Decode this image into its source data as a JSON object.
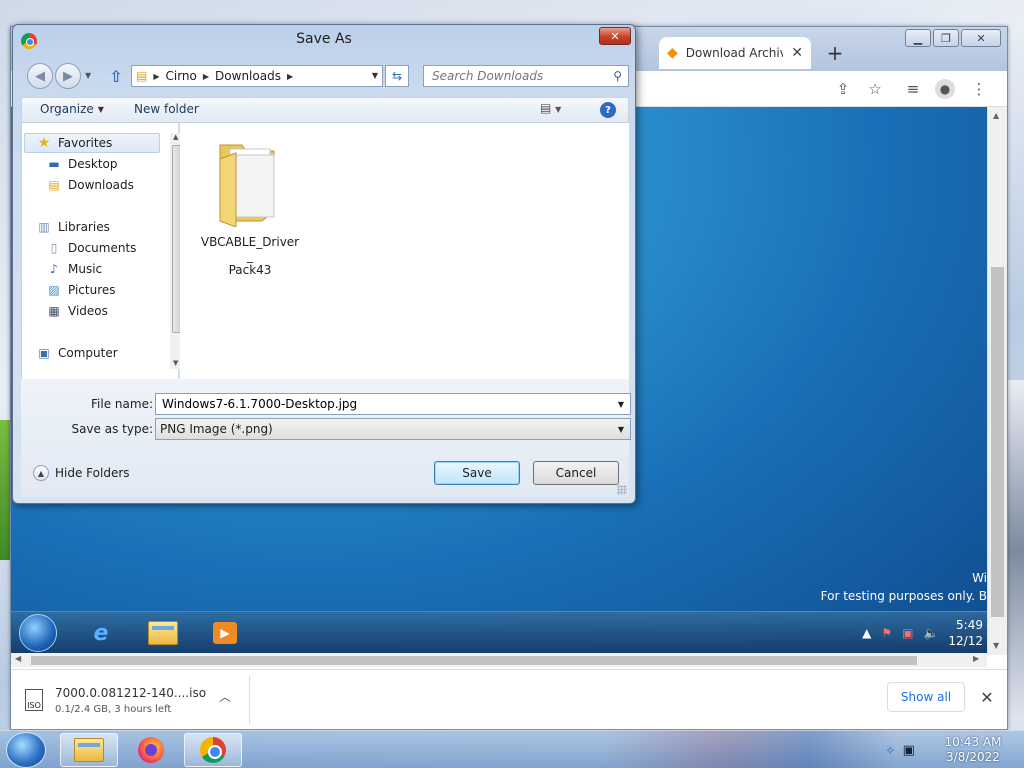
{
  "dialog": {
    "title": "Save As",
    "nav": {
      "path": [
        "Cirno",
        "Downloads"
      ],
      "search_placeholder": "Search Downloads"
    },
    "commands": {
      "organize": "Organize",
      "new_folder": "New folder"
    },
    "nav_pane": {
      "favorites": "Favorites",
      "desktop": "Desktop",
      "downloads": "Downloads",
      "libraries": "Libraries",
      "documents": "Documents",
      "music": "Music",
      "pictures": "Pictures",
      "videos": "Videos",
      "computer": "Computer"
    },
    "files": [
      {
        "name": "VBCABLE_Driver_\nPack43",
        "type": "folder"
      }
    ],
    "file_name_label": "File name:",
    "file_name_value": "Windows7-6.1.7000-Desktop.jpg",
    "save_type_label": "Save as type:",
    "save_type_value": "PNG Image (*.png)",
    "save_label": "Save",
    "cancel_label": "Cancel",
    "hide_folders_label": "Hide Folders"
  },
  "browser": {
    "tab_title": "Download Archiv",
    "content": {
      "watermark_line1": "Wi",
      "watermark_line2": "For testing purposes only. B",
      "vm_clock_time": "5:49",
      "vm_clock_date": "12/12"
    },
    "download_shelf": {
      "file_name": "7000.0.081212-140....iso",
      "status": "0.1/2.4 GB, 3 hours left",
      "icon_text": "ISO",
      "show_all": "Show all"
    }
  },
  "taskbar": {
    "time": "10:43 AM",
    "date": "3/8/2022"
  },
  "colors": {
    "accent_link": "#1a73e8",
    "dialog_close": "#c8412a",
    "vm_desktop": "#1a6fb6"
  }
}
